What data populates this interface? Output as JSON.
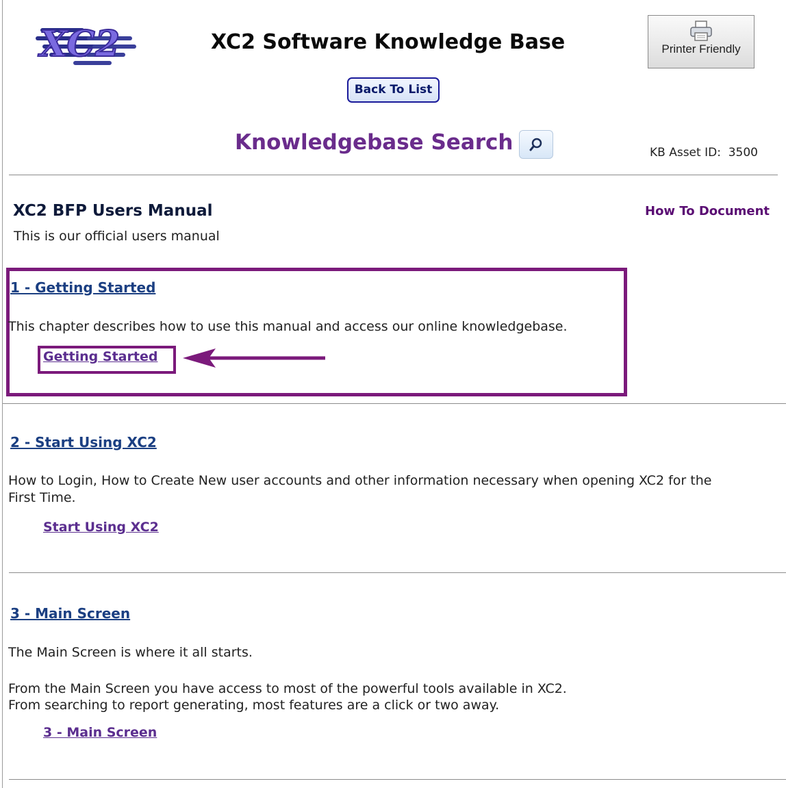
{
  "header": {
    "logo_text": "XC2",
    "site_title": "XC2 Software Knowledge Base",
    "printer_label": "Printer Friendly",
    "back_label": "Back To List",
    "search_title": "Knowledgebase Search",
    "asset_id": "KB Asset ID:  3500"
  },
  "document": {
    "title": "XC2 BFP Users Manual",
    "type": "How To Document",
    "description": "This is our official users manual"
  },
  "chapters": [
    {
      "title": "1 - Getting Started",
      "lines": [
        "This chapter describes how to use this manual and access our online knowledgebase."
      ],
      "link": "Getting Started"
    },
    {
      "title": "2 - Start Using XC2",
      "lines": [
        "How to Login, How to Create New user accounts and other information necessary when opening XC2 for the",
        "First Time."
      ],
      "link": "Start Using XC2"
    },
    {
      "title": "3 - Main Screen",
      "lines": [
        "The Main Screen is where it all starts.",
        "From the Main Screen you have access to most of the powerful tools available in XC2.",
        "From searching to report generating, most features are a click or two away."
      ],
      "link": "3 - Main Screen"
    }
  ],
  "colors": {
    "highlight": "#7b1a7b",
    "search_title": "#6a2c8c",
    "chapter_link": "#1b3f82",
    "sub_link": "#5b2e8f"
  }
}
